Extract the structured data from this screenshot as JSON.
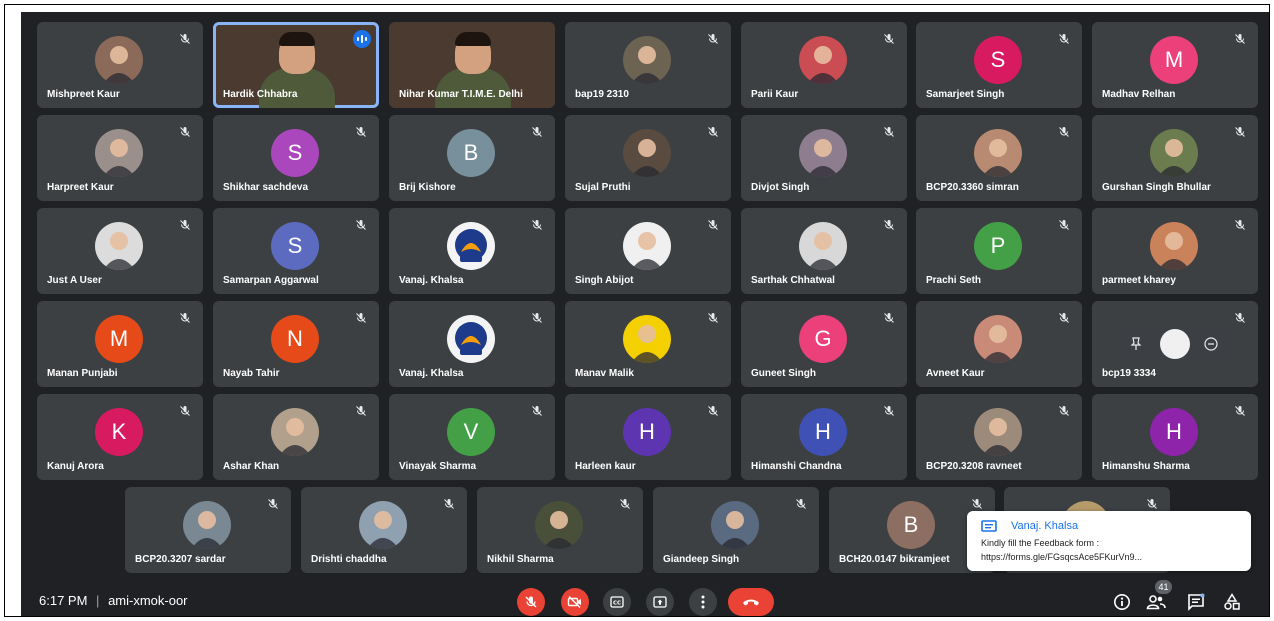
{
  "meeting": {
    "time": "6:17 PM",
    "separator": "|",
    "code": "ami-xmok-oor",
    "participant_count": "41"
  },
  "participants": [
    {
      "name": "Mishpreet Kaur",
      "kind": "photo",
      "color": "#8b6a5a"
    },
    {
      "name": "Hardik Chhabra",
      "kind": "video",
      "speaking": true
    },
    {
      "name": "Nihar Kumar T.I.M.E. Delhi",
      "kind": "video"
    },
    {
      "name": "bap19 2310",
      "kind": "photo",
      "color": "#6d6352"
    },
    {
      "name": "Parii Kaur",
      "kind": "photo",
      "color": "#c94d52"
    },
    {
      "name": "Samarjeet Singh",
      "kind": "letter",
      "letter": "S",
      "color": "#d81b60"
    },
    {
      "name": "Madhav Relhan",
      "kind": "letter",
      "letter": "M",
      "color": "#ec407a"
    },
    {
      "name": "Harpreet Kaur",
      "kind": "photo",
      "color": "#9a8f8a"
    },
    {
      "name": "Shikhar sachdeva",
      "kind": "letter",
      "letter": "S",
      "color": "#ab47bc"
    },
    {
      "name": "Brij Kishore",
      "kind": "letter",
      "letter": "B",
      "color": "#78909c"
    },
    {
      "name": "Sujal Pruthi",
      "kind": "photo",
      "color": "#5a4b40"
    },
    {
      "name": "Divjot Singh",
      "kind": "photo",
      "color": "#8e7c8f"
    },
    {
      "name": "BCP20.3360 simran",
      "kind": "photo",
      "color": "#b98a72"
    },
    {
      "name": "Gurshan Singh Bhullar",
      "kind": "photo",
      "color": "#6b7d4e"
    },
    {
      "name": "Just A User",
      "kind": "photo",
      "color": "#dcdcdc"
    },
    {
      "name": "Samarpan Aggarwal",
      "kind": "letter",
      "letter": "S",
      "color": "#5c6bc0"
    },
    {
      "name": "Vanaj. Khalsa",
      "kind": "logo",
      "color": "#f2f2f2"
    },
    {
      "name": "Singh Abijot",
      "kind": "photo",
      "color": "#f0f0f0"
    },
    {
      "name": "Sarthak Chhatwal",
      "kind": "photo",
      "color": "#d8d8d8"
    },
    {
      "name": "Prachi Seth",
      "kind": "letter",
      "letter": "P",
      "color": "#43a047"
    },
    {
      "name": "parmeet kharey",
      "kind": "photo",
      "color": "#c9825a"
    },
    {
      "name": "Manan Punjabi",
      "kind": "letter",
      "letter": "M",
      "color": "#e64a19"
    },
    {
      "name": "Nayab Tahir",
      "kind": "letter",
      "letter": "N",
      "color": "#e64a19"
    },
    {
      "name": "Vanaj. Khalsa",
      "kind": "logo",
      "color": "#f2f2f2"
    },
    {
      "name": "Manav Malik",
      "kind": "photo",
      "color": "#f5d000"
    },
    {
      "name": "Guneet Singh",
      "kind": "letter",
      "letter": "G",
      "color": "#ec407a"
    },
    {
      "name": "Avneet Kaur",
      "kind": "photo",
      "color": "#c98a78"
    },
    {
      "name": "bcp19 3334",
      "kind": "hover",
      "color": "#eeeeee"
    },
    {
      "name": "Kanuj Arora",
      "kind": "letter",
      "letter": "K",
      "color": "#d81b60"
    },
    {
      "name": "Ashar Khan",
      "kind": "photo",
      "color": "#b0a08c"
    },
    {
      "name": "Vinayak Sharma",
      "kind": "letter",
      "letter": "V",
      "color": "#43a047"
    },
    {
      "name": "Harleen kaur",
      "kind": "letter",
      "letter": "H",
      "color": "#5e35b1"
    },
    {
      "name": "Himanshi Chandna",
      "kind": "letter",
      "letter": "H",
      "color": "#3f51b5"
    },
    {
      "name": "BCP20.3208 ravneet",
      "kind": "photo",
      "color": "#9c8b7a"
    },
    {
      "name": "Himanshu Sharma",
      "kind": "letter",
      "letter": "H",
      "color": "#8e24aa"
    },
    {
      "name": "BCP20.3207 sardar",
      "kind": "photo",
      "color": "#7a8894"
    },
    {
      "name": "Drishti chaddha",
      "kind": "photo",
      "color": "#8fa0b0"
    },
    {
      "name": "Nikhil Sharma",
      "kind": "photo",
      "color": "#4a4f3a"
    },
    {
      "name": "Giandeep Singh",
      "kind": "photo",
      "color": "#5a6a80"
    },
    {
      "name": "BCH20.0147 bikramjeet",
      "kind": "letter",
      "letter": "B",
      "color": "#8d6e63"
    },
    {
      "name": "",
      "kind": "photo",
      "color": "#b59a6a"
    }
  ],
  "chat_toast": {
    "sender": "Vanaj. Khalsa",
    "line1": "Kindly fill the Feedback form :",
    "line2": "https://forms.gle/FGsqcsAce5FKurVn9..."
  },
  "controls": {
    "mic_icon": "mic-off-icon",
    "camera_icon": "camera-off-icon",
    "captions_icon": "captions-icon",
    "present_icon": "present-icon",
    "more_icon": "more-vert-icon",
    "end_call_icon": "end-call-icon",
    "info_icon": "info-icon",
    "people_icon": "people-icon",
    "chat_icon": "chat-icon",
    "activities_icon": "activities-icon"
  },
  "colors": {
    "background": "#202124",
    "tile": "#3c4043",
    "red": "#ea4335",
    "blue": "#1a73e8"
  }
}
